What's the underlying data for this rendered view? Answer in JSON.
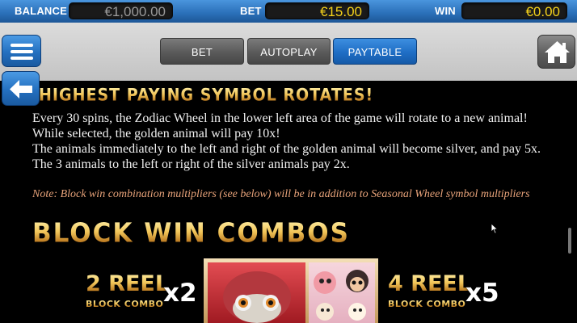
{
  "topbar": {
    "balance_label": "BALANCE",
    "balance_value": "€1,000.00",
    "bet_label": "BET",
    "bet_value": "€15.00",
    "win_label": "WIN",
    "win_value": "€0.00"
  },
  "tabs": [
    {
      "label": "BET"
    },
    {
      "label": "AUTOPLAY"
    },
    {
      "label": "PAYTABLE",
      "active": true
    }
  ],
  "icons": {
    "menu": "hamburger-menu-icon",
    "home": "home-icon",
    "back": "left-arrow-icon"
  },
  "paytable": {
    "heading": "HIGHEST PAYING SYMBOL ROTATES!",
    "paragraph1": "Every 30 spins, the Zodiac Wheel in the lower left area of the game will rotate to a new animal! While selected, the golden animal will pay 10x!",
    "paragraph2": "The animals immediately to the left and right of the golden animal will become silver, and pay 5x. The 3 animals to the left or right of the silver animals pay 2x.",
    "note": "Note: Block win combination multipliers (see below) will be in addition to Seasonal Wheel symbol multipliers",
    "section_title": "BLOCK WIN COMBOS",
    "combos": [
      {
        "title": "2 REEL",
        "subtitle": "BLOCK COMBO",
        "multiplier": "x2"
      },
      {
        "title": "4 REEL",
        "subtitle": "BLOCK COMBO",
        "multiplier": "x5"
      }
    ]
  },
  "colors": {
    "accent_blue": "#2470c0",
    "balance_text": "#9a9a9a",
    "bet_text": "#f5d21a",
    "win_text": "#f5d21a",
    "note_text": "#e8a37a"
  }
}
